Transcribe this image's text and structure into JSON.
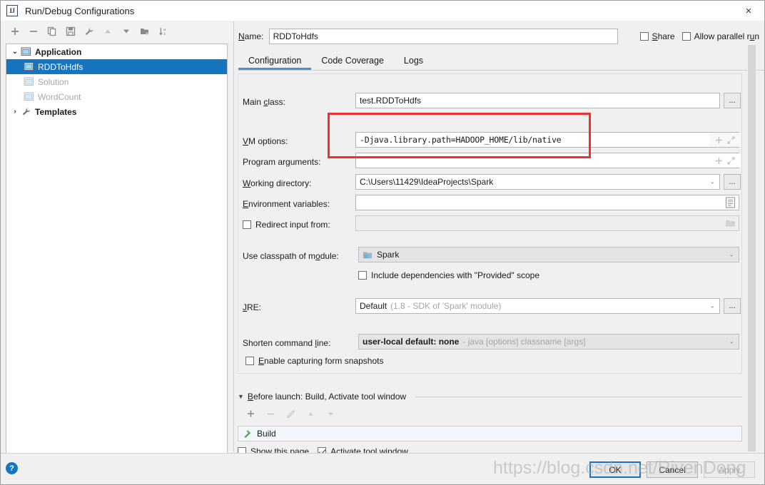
{
  "window": {
    "title": "Run/Debug Configurations",
    "app_icon": "IJ",
    "close_icon": "×"
  },
  "left_panel": {
    "toolbar": [
      {
        "name": "add-button",
        "icon": "plus-icon",
        "label": "+"
      },
      {
        "name": "remove-button",
        "icon": "minus-icon",
        "label": "−"
      },
      {
        "name": "copy-button",
        "icon": "copy-icon",
        "label": "Copy Configuration"
      },
      {
        "name": "save-button",
        "icon": "save-icon",
        "label": "Save Configuration"
      },
      {
        "name": "edit-templates-button",
        "icon": "wrench-icon",
        "label": "Edit Templates"
      },
      {
        "name": "move-up-button",
        "icon": "arrow-up-icon",
        "label": "Move Up"
      },
      {
        "name": "move-down-button",
        "icon": "arrow-down-icon",
        "label": "Move Down"
      },
      {
        "name": "new-folder-button",
        "icon": "folder-add-icon",
        "label": "Create New Folder"
      },
      {
        "name": "sort-button",
        "icon": "sort-az-icon",
        "label": "Sort Configurations"
      }
    ],
    "tree": [
      {
        "label": "Application",
        "level": 0,
        "chevron": "⌄",
        "bold": true,
        "selected": false,
        "dim": false,
        "icon": "application-icon"
      },
      {
        "label": "RDDToHdfs",
        "level": 1,
        "chevron": "",
        "bold": false,
        "selected": true,
        "dim": false,
        "icon": "run-config-icon"
      },
      {
        "label": "Solution",
        "level": 1,
        "chevron": "",
        "bold": false,
        "selected": false,
        "dim": true,
        "icon": "run-config-icon"
      },
      {
        "label": "WordCount",
        "level": 1,
        "chevron": "",
        "bold": false,
        "selected": false,
        "dim": true,
        "icon": "run-config-icon"
      },
      {
        "label": "Templates",
        "level": 0,
        "chevron": "›",
        "bold": true,
        "selected": false,
        "dim": false,
        "icon": "wrench-icon"
      }
    ]
  },
  "header": {
    "name_label": "Name:",
    "name_value": "RDDToHdfs",
    "share_label": "Share",
    "share_checked": false,
    "allow_parallel_label": "Allow parallel run",
    "allow_parallel_checked": false
  },
  "tabs": [
    {
      "label": "Configuration",
      "active": true
    },
    {
      "label": "Code Coverage",
      "active": false
    },
    {
      "label": "Logs",
      "active": false
    }
  ],
  "form": {
    "main_class": {
      "label": "Main class:",
      "value": "test.RDDToHdfs",
      "browse_label": "..."
    },
    "vm_options": {
      "label": "VM options:",
      "value": "-Djava.library.path=HADOOP_HOME/lib/native",
      "expand_icon": "expand-icon",
      "insert_icon": "insert-macro-icon"
    },
    "program_arguments": {
      "label": "Program arguments:",
      "value": "",
      "expand_icon": "expand-icon",
      "insert_icon": "insert-macro-icon"
    },
    "working_directory": {
      "label": "Working directory:",
      "value": "C:\\Users\\11429\\IdeaProjects\\Spark",
      "browse_label": "..."
    },
    "environment_variables": {
      "label": "Environment variables:",
      "value": "",
      "browse_icon": "env-list-icon"
    },
    "redirect_input": {
      "label": "Redirect input from:",
      "checked": false,
      "value": "",
      "browse_icon": "folder-icon"
    },
    "use_classpath_of_module": {
      "label": "Use classpath of module:",
      "value": "Spark",
      "module_icon": "module-icon"
    },
    "include_dependencies": {
      "label": "Include dependencies with \"Provided\" scope",
      "checked": false
    },
    "jre": {
      "label": "JRE:",
      "value": "Default",
      "hint": "(1.8 - SDK of 'Spark' module)",
      "browse_label": "..."
    },
    "shorten_command_line": {
      "label": "Shorten command line:",
      "value": "user-local default: none",
      "hint": "- java [options] classname [args]"
    },
    "enable_capturing_form_snapshots": {
      "label": "Enable capturing form snapshots",
      "checked": false
    }
  },
  "before_launch": {
    "header": "Before launch: Build, Activate tool window",
    "collapse_icon": "triangle-down-icon",
    "toolbar": [
      {
        "name": "bl-add-button",
        "icon": "plus-icon",
        "label": "+",
        "enabled": true
      },
      {
        "name": "bl-remove-button",
        "icon": "minus-icon",
        "label": "−",
        "enabled": false
      },
      {
        "name": "bl-edit-button",
        "icon": "pencil-icon",
        "label": "Edit",
        "enabled": false
      },
      {
        "name": "bl-move-up-button",
        "icon": "arrow-up-icon",
        "label": "Move Up",
        "enabled": false
      },
      {
        "name": "bl-move-down-button",
        "icon": "arrow-down-icon",
        "label": "Move Down",
        "enabled": false
      }
    ],
    "items": [
      {
        "label": "Build",
        "icon": "hammer-icon"
      }
    ],
    "show_this_page": {
      "label": "Show this page",
      "checked": false
    },
    "activate_tool_window": {
      "label": "Activate tool window",
      "checked": true
    }
  },
  "footer": {
    "help_label": "?",
    "ok_label": "OK",
    "cancel_label": "Cancel",
    "apply_label": "Apply",
    "apply_enabled": false
  },
  "watermark": {
    "text": "https://blog.csdn.net/RivenDong"
  },
  "colors": {
    "accent": "#1675c0",
    "tab_underline": "#4a90d9",
    "highlight_box": "#f03030",
    "selection": "#1675c0",
    "panel_bg": "#f0f0f0"
  }
}
